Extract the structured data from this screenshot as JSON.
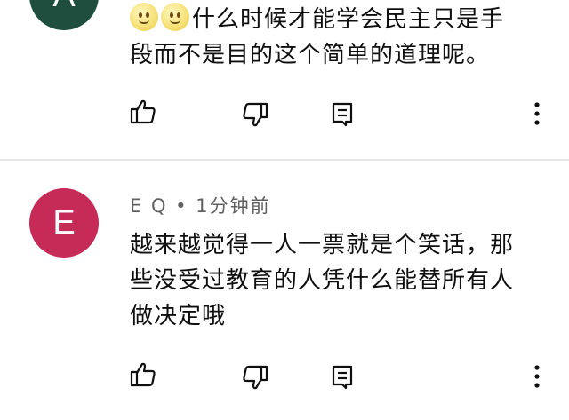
{
  "comments": [
    {
      "avatar_letter": "A",
      "avatar_color": "#1f4d3e",
      "emojis": [
        "slightly-smiling-face",
        "slightly-smiling-face"
      ],
      "text_line1": "什么时候才能学会民主只是手",
      "text_line2": "段而不是目的这个简单的道理呢。"
    },
    {
      "avatar_letter": "E",
      "avatar_color": "#c62a57",
      "author": "E Q",
      "separator": "•",
      "time": "1分钟前",
      "text_line1": "越来越觉得一人一票就是个笑话，那",
      "text_line2": "些没受过教育的人凭什么能替所有人",
      "text_line3": "做决定哦"
    }
  ],
  "icons": {
    "like": "thumbs-up-icon",
    "dislike": "thumbs-down-icon",
    "reply": "reply-comment-icon",
    "more": "more-vertical-icon"
  }
}
